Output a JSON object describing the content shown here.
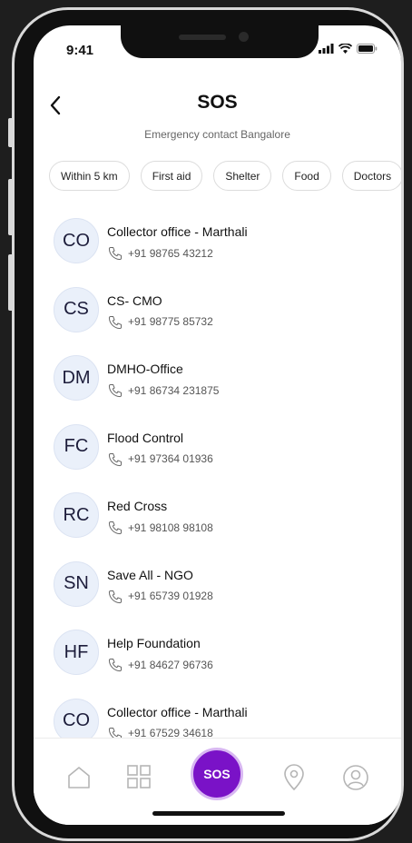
{
  "status_bar": {
    "time": "9:41"
  },
  "header": {
    "title": "SOS",
    "subtitle": "Emergency contact Bangalore"
  },
  "filters": [
    "Within 5 km",
    "First aid",
    "Shelter",
    "Food",
    "Doctors"
  ],
  "contacts": [
    {
      "initials": "CO",
      "name": "Collector office - Marthali",
      "phone": "+91 98765 43212"
    },
    {
      "initials": "CS",
      "name": "CS- CMO",
      "phone": "+91 98775 85732"
    },
    {
      "initials": "DM",
      "name": "DMHO-Office",
      "phone": "+91 86734 231875"
    },
    {
      "initials": "FC",
      "name": "Flood Control",
      "phone": "+91 97364 01936"
    },
    {
      "initials": "RC",
      "name": "Red Cross",
      "phone": "+91 98108 98108"
    },
    {
      "initials": "SN",
      "name": "Save All - NGO",
      "phone": "+91 65739 01928"
    },
    {
      "initials": "HF",
      "name": "Help Foundation",
      "phone": "+91 84627 96736"
    },
    {
      "initials": "CO",
      "name": "Collector office - Marthali",
      "phone": "+91 67529 34618"
    }
  ],
  "nav": {
    "items": [
      "home-icon",
      "grid-icon",
      "sos",
      "location-icon",
      "profile-icon"
    ],
    "sos_label": "SOS",
    "active": "sos"
  },
  "colors": {
    "accent": "#7a12c7",
    "avatar_bg": "#eaf0fa"
  }
}
